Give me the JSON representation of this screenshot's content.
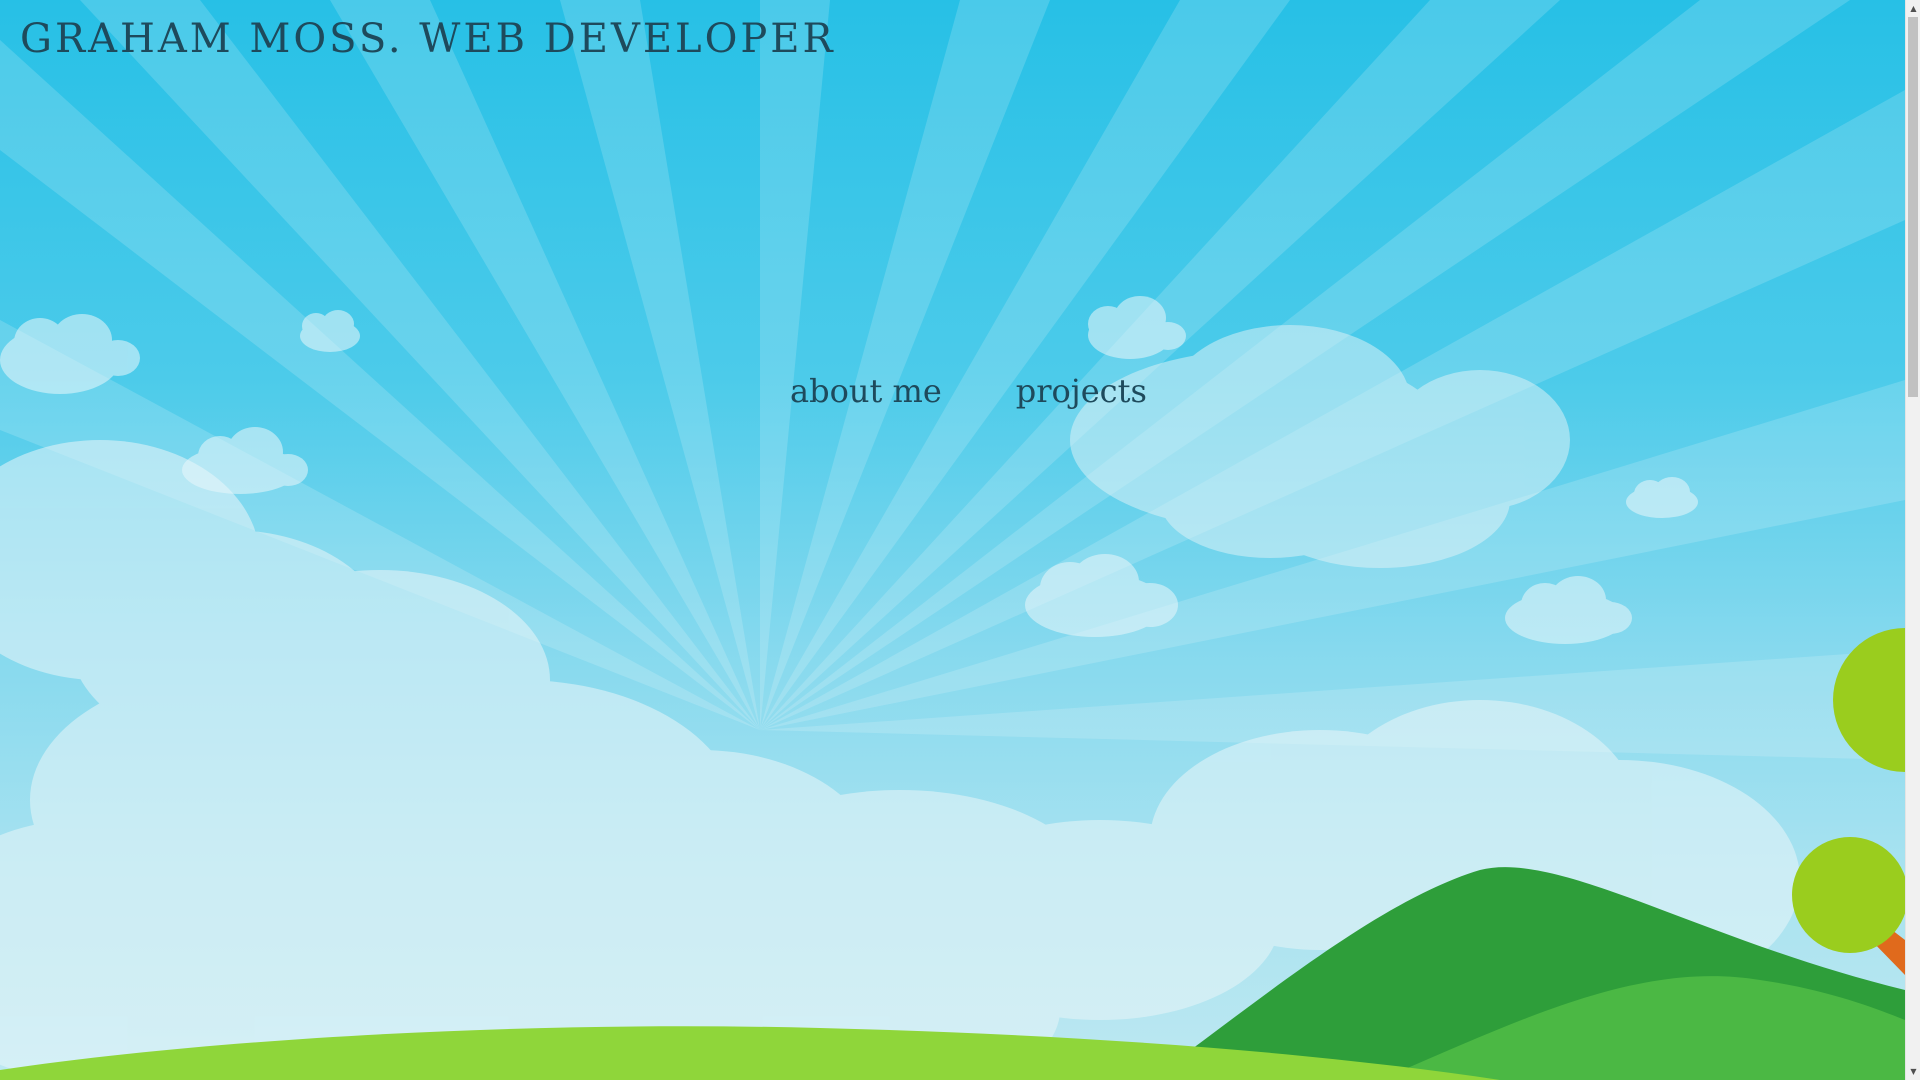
{
  "header": {
    "title": "GRAHAM MOSS. WEB DEVELOPER"
  },
  "nav": {
    "items": [
      {
        "label": "about me"
      },
      {
        "label": "projects"
      }
    ]
  },
  "scrollbar": {
    "up_icon": "scroll-up-arrow-icon",
    "down_icon": "scroll-down-arrow-icon",
    "up_glyph": "▲",
    "down_glyph": "▼"
  },
  "colors": {
    "sky_top": "#27c0e6",
    "sky_bottom": "#bde8f1",
    "text": "#1e4a5c",
    "hill_dark": "#2e9e3a",
    "hill_light": "#8fd63a",
    "tree_foliage": "#9acd1e",
    "tree_trunk": "#e06a1c"
  }
}
